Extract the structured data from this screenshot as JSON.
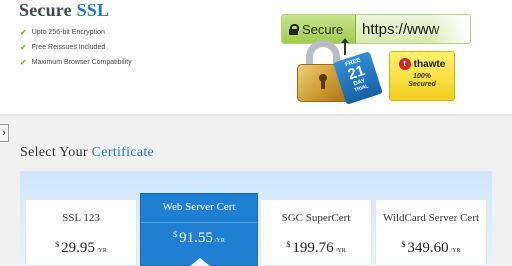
{
  "hero": {
    "title_part1": "Secure",
    "title_part2": "SSL",
    "features": [
      "Upto 256-bit Encryption",
      "Free Reissues Included",
      "Maximum Browser Compatibility"
    ],
    "urlbar": {
      "secure_label": "Secure",
      "url_text": "https://www"
    },
    "trial_badge": {
      "line1": "FREE",
      "line2": "21",
      "line3": "DAY",
      "line4": "TRIAL"
    },
    "thawte": {
      "logo_text": "thawte",
      "logo_letter": "t",
      "subtext_line1": "100%",
      "subtext_line2": "Secured"
    },
    "side_tab_glyph": "›"
  },
  "section": {
    "title_part1": "Select Your",
    "title_part2": "Certificate"
  },
  "plans": [
    {
      "name": "SSL 123",
      "currency": "$",
      "amount": "29.95",
      "period": "/YR"
    },
    {
      "name": "Web Server Cert",
      "currency": "$",
      "amount": "91.55",
      "period": "/YR"
    },
    {
      "name": "SGC SuperCert",
      "currency": "$",
      "amount": "199.76",
      "period": "/YR"
    },
    {
      "name": "WildCard Server Cert",
      "currency": "$",
      "amount": "349.60",
      "period": "/YR"
    }
  ],
  "colors": {
    "accent_blue": "#1d79c7",
    "featured_blue": "#1f7fd3",
    "check_green": "#7fbf2a",
    "secure_green": "#9fce4b"
  },
  "icons": {
    "check": "check-icon",
    "lock": "lock-icon",
    "padlock": "padlock-illustration",
    "side_tab": "chevron-right-icon"
  }
}
